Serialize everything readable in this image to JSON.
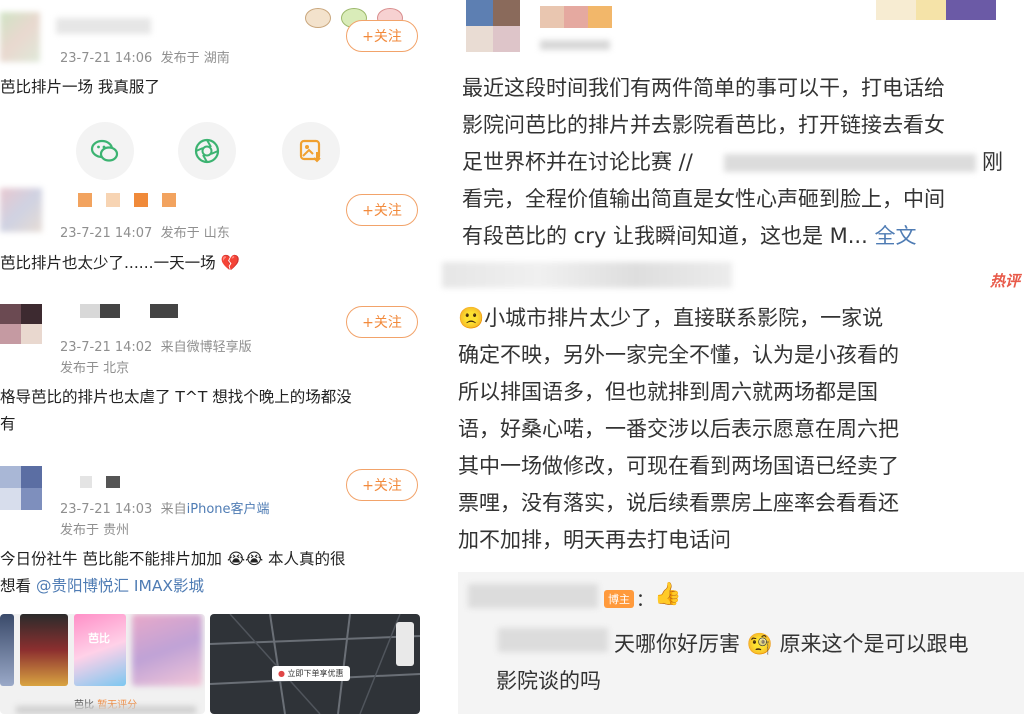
{
  "left": {
    "posts": [
      {
        "time": "23-7-21 14:06",
        "source": "发布于 湖南",
        "follow_label": "+关注",
        "text": "芭比排片一场 我真服了"
      },
      {
        "time": "23-7-21 14:07",
        "source": "发布于 山东",
        "follow_label": "+关注",
        "text": "芭比排片也太少了......一天一场"
      },
      {
        "time": "23-7-21 14:02",
        "source": "来自微博轻享版",
        "location": "发布于 北京",
        "follow_label": "+关注",
        "text_line1": "格导芭比的排片也太虐了 T^T 想找个晚上的场都没",
        "text_line2": "有"
      },
      {
        "time": "23-7-21 14:03",
        "source_prefix": "来自",
        "device": "iPhone客户端",
        "location": "发布于 贵州",
        "follow_label": "+关注",
        "text_line1": "今日份社牛 芭比能不能排片加加",
        "text_line1_tail": "本人真的很",
        "text_line2_prefix": "想看",
        "mention": "@贵阳博悦汇 IMAX影城"
      }
    ],
    "thumb": {
      "poster_label": "芭比",
      "caption_title": "芭比",
      "caption_sub": "暂无评分",
      "map_label": "立即下单享优惠"
    }
  },
  "right": {
    "main_text": [
      "最近这段时间我们有两件简单的事可以干，打电话给",
      "影院问芭比的排片并去影院看芭比，打开链接去看女",
      "足世界杯并在讨论比赛 //",
      "看完，全程价值输出简直是女性心声砸到脸上，中间",
      "有段芭比的 cry 让我瞬间知道，这也是 M..."
    ],
    "main_line3_tail": "刚",
    "more_label": "全文",
    "hot_label": "热评",
    "comment_lines": [
      "小城市排片太少了，直接联系影院，一家说",
      "确定不映，另外一家完全不懂，认为是小孩看的",
      "所以排国语多，但也就排到周六就两场都是国",
      "语，好桑心喏，一番交涉以后表示愿意在周六把",
      "其中一场做修改，可现在看到两场国语已经卖了",
      "票哩，没有落实，说后续看票房上座率会看看还",
      "加不加排，明天再去打电话问"
    ],
    "author_tag": "博主",
    "reply_line1_a": "天哪你好厉害",
    "reply_line1_b": "原来这个是可以跟电",
    "reply_line2": "影院谈的吗",
    "reply_colon": "："
  }
}
